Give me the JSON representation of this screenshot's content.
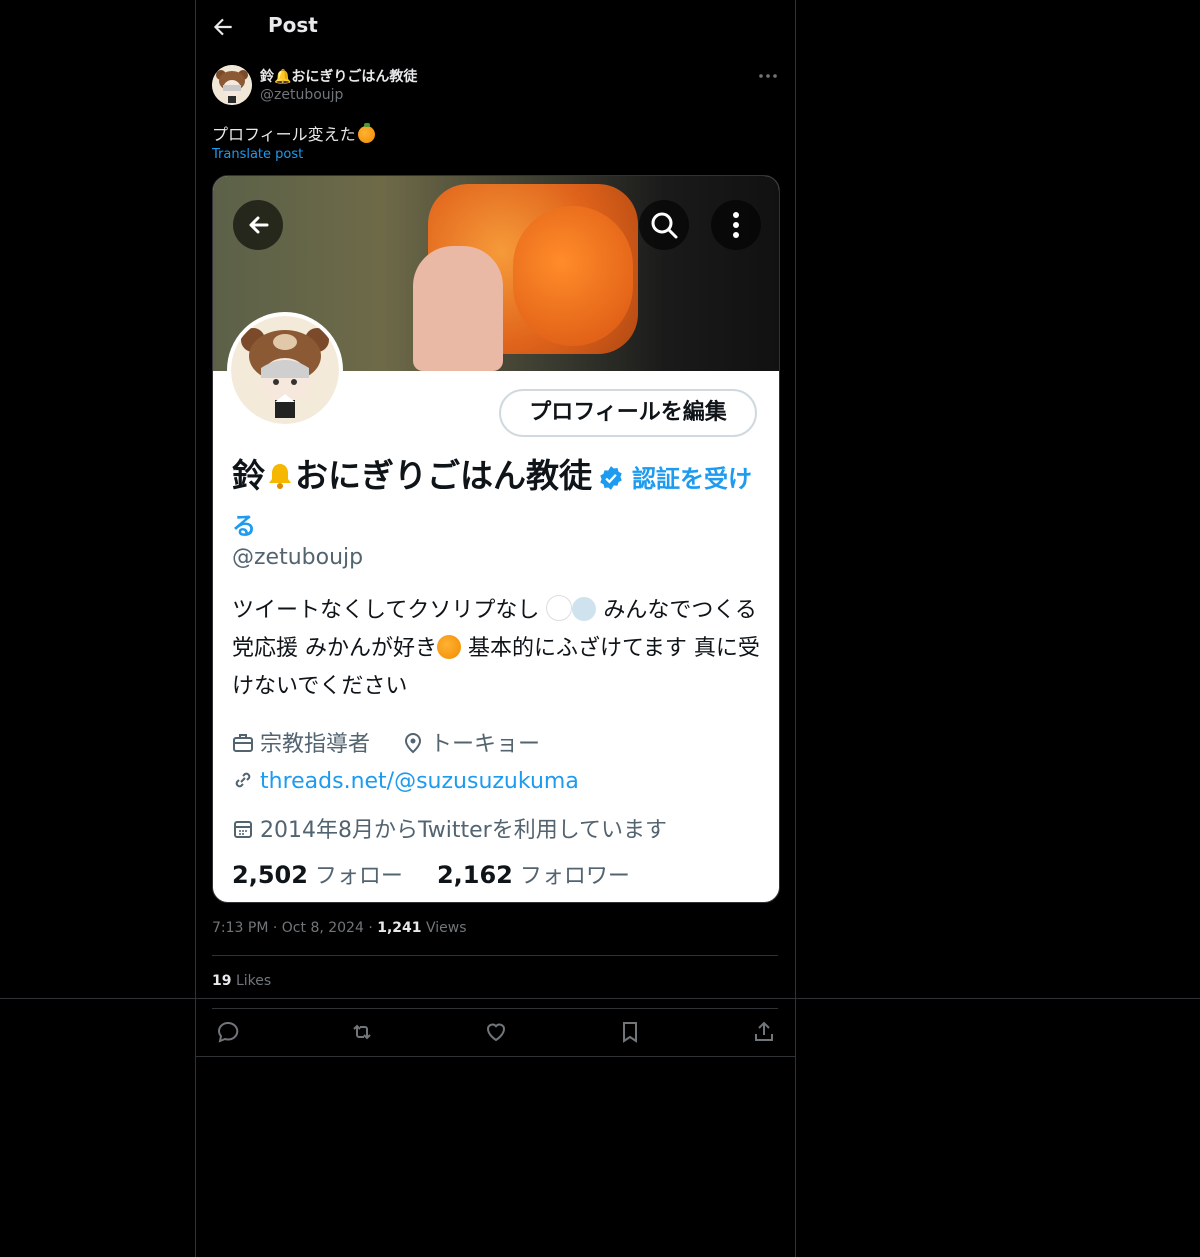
{
  "header": {
    "title": "Post"
  },
  "post": {
    "author_name": "鈴🔔おにぎりごはん教徒",
    "author_handle": "@zetuboujp",
    "text": "プロフィール変えた",
    "translate": "Translate post",
    "time": "7:13 PM",
    "date": "Oct 8, 2024",
    "views_count": "1,241",
    "views_label": "Views",
    "likes_count": "19",
    "likes_label": "Likes"
  },
  "screenshot": {
    "edit_button": "プロフィールを編集",
    "name": "鈴",
    "name_rest": "おにぎりごはん教徒",
    "verify_link": "認証を受ける",
    "handle": "@zetuboujp",
    "bio_1": "ツイートなくしてクソリプなし",
    "bio_2": "みんなでつくる党応援 みかんが好き",
    "bio_3": "基本的にふざけてます 真に受けないでください",
    "job": "宗教指導者",
    "location": "トーキョー",
    "link": "threads.net/@suzusuzukuma",
    "joined": "2014年8月からTwitterを利用しています",
    "following_count": "2,502",
    "following_label": "フォロー",
    "followers_count": "2,162",
    "followers_label": "フォロワー"
  },
  "colors": {
    "accent": "#1d9bf0",
    "background": "#000000",
    "muted": "#71767b",
    "border": "#2f3336"
  }
}
